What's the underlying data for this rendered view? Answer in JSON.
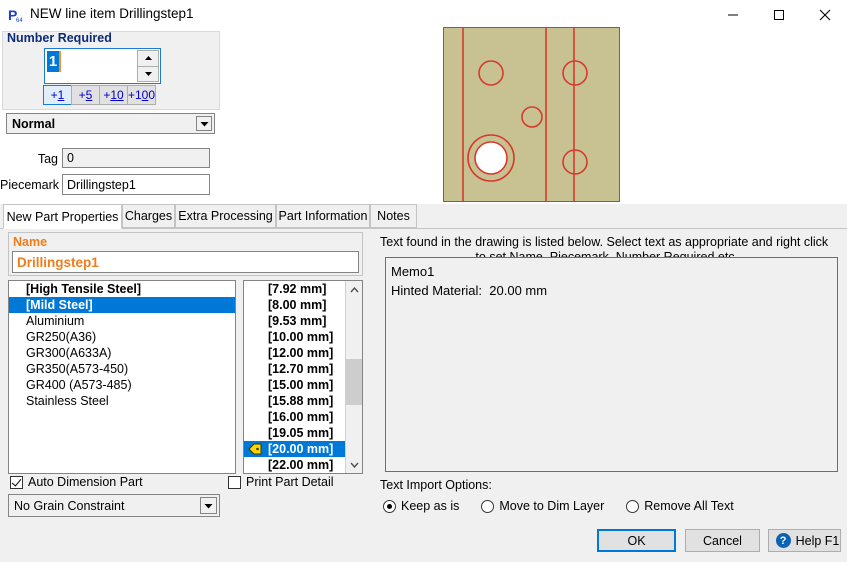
{
  "window": {
    "title": "NEW line item Drillingstep1",
    "app_icon": "p-app-icon",
    "minimize": "minimize-icon",
    "maximize": "maximize-icon",
    "close": "close-icon"
  },
  "number_required": {
    "group_title": "Number Required",
    "value": "1",
    "increments": [
      {
        "label": "+1",
        "underline": "1",
        "selected": true
      },
      {
        "label": "+5",
        "underline": "5",
        "selected": false
      },
      {
        "label": "+10",
        "underline": "10",
        "selected": false
      },
      {
        "label": "+100",
        "underline": "0",
        "selected": false
      }
    ]
  },
  "type_combo": {
    "value": "Normal"
  },
  "tag": {
    "label": "Tag",
    "value": "0"
  },
  "piecemark": {
    "label": "Piecemark",
    "value": "Drillingstep1"
  },
  "preview": {
    "background_color": "#c8c191",
    "line_color": "#d63a2f",
    "hole_fill": "#ffffff"
  },
  "tabs": [
    {
      "label": "New Part Properties",
      "active": true
    },
    {
      "label": "Charges",
      "active": false
    },
    {
      "label": "Extra Processing",
      "active": false
    },
    {
      "label": "Part Information",
      "active": false
    },
    {
      "label": "Notes",
      "active": false
    }
  ],
  "name_field": {
    "label": "Name",
    "value": "Drillingstep1",
    "color": "#ef7d1a"
  },
  "materials": {
    "items": [
      {
        "label": "[High Tensile Steel]",
        "bold": true,
        "selected": false
      },
      {
        "label": "[Mild Steel]",
        "bold": true,
        "selected": true
      },
      {
        "label": "Aluminium",
        "bold": false,
        "selected": false
      },
      {
        "label": "GR250(A36)",
        "bold": false,
        "selected": false
      },
      {
        "label": "GR300(A633A)",
        "bold": false,
        "selected": false
      },
      {
        "label": "GR350(A573-450)",
        "bold": false,
        "selected": false
      },
      {
        "label": "GR400 (A573-485)",
        "bold": false,
        "selected": false
      },
      {
        "label": "Stainless Steel",
        "bold": false,
        "selected": false
      }
    ]
  },
  "thicknesses": {
    "items": [
      {
        "label": "[7.92 mm]",
        "selected": false,
        "icon": false
      },
      {
        "label": "[8.00 mm]",
        "selected": false,
        "icon": false
      },
      {
        "label": "[9.53 mm]",
        "selected": false,
        "icon": false
      },
      {
        "label": "[10.00 mm]",
        "selected": false,
        "icon": false
      },
      {
        "label": "[12.00 mm]",
        "selected": false,
        "icon": false
      },
      {
        "label": "[12.70 mm]",
        "selected": false,
        "icon": false
      },
      {
        "label": "[15.00 mm]",
        "selected": false,
        "icon": false
      },
      {
        "label": "[15.88 mm]",
        "selected": false,
        "icon": false
      },
      {
        "label": "[16.00 mm]",
        "selected": false,
        "icon": false
      },
      {
        "label": "[19.05 mm]",
        "selected": false,
        "icon": false
      },
      {
        "label": "[20.00 mm]",
        "selected": true,
        "icon": true
      },
      {
        "label": "[22.00 mm]",
        "selected": false,
        "icon": false
      }
    ]
  },
  "auto_dimension": {
    "label": "Auto Dimension Part",
    "checked": true
  },
  "print_part_detail": {
    "label": "Print Part Detail",
    "checked": false
  },
  "grain_combo": {
    "value": "No Grain Constraint"
  },
  "text_panel": {
    "header_line1": "Text found in the drawing is listed below.  Select text as appropriate and right click",
    "header_line2": "to set Name, Piecemark, Number Required etc",
    "memo_lines": [
      "Memo1",
      "Hinted Material:  20.00 mm"
    ],
    "options_label": "Text Import Options:",
    "options": [
      {
        "label": "Keep as is",
        "selected": true
      },
      {
        "label": "Move to Dim Layer",
        "selected": false
      },
      {
        "label": "Remove All Text",
        "selected": false
      }
    ]
  },
  "footer": {
    "ok": "OK",
    "cancel": "Cancel",
    "help": "Help F1",
    "help_glyph": "?"
  }
}
